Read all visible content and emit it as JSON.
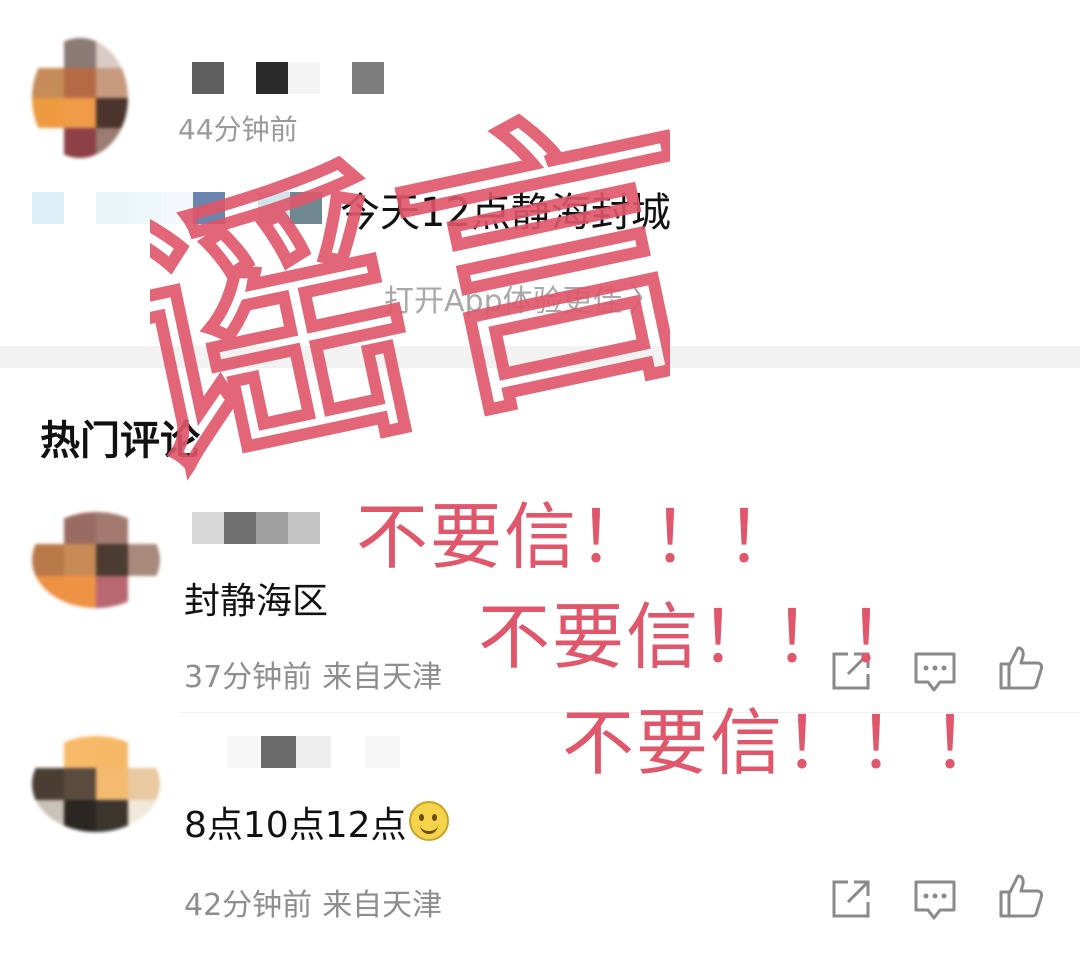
{
  "post": {
    "time": "44分钟前",
    "text": "今天12点静海封城",
    "open_app": "打开App体验更佳",
    "open_app_chevron": "chevron-right-icon"
  },
  "comments_section": {
    "title": "热门评论"
  },
  "comments": [
    {
      "text": "封静海区",
      "time": "37分钟前",
      "location": "来自天津"
    },
    {
      "text": "8点10点12点",
      "emoji": "grinning-face-emoji",
      "time": "42分钟前",
      "location": "来自天津"
    }
  ],
  "actions": {
    "share_icon": "share-icon",
    "reply_icon": "comment-icon",
    "like_icon": "thumbs-up-icon"
  },
  "overlay": {
    "stamp": "谣言",
    "warning": "不要信！！！",
    "color": "#e0566a"
  },
  "colors": {
    "meta": "#8e8e8e",
    "text": "#111111",
    "divider": "#f2f2f2"
  }
}
